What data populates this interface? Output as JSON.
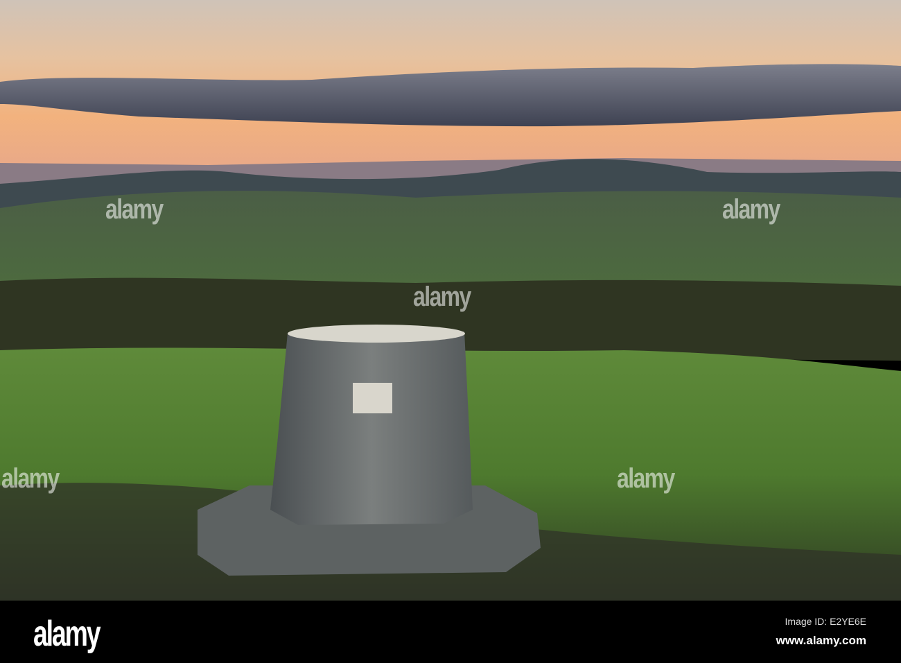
{
  "watermark": {
    "text": "alamy"
  },
  "footer": {
    "logo": "alamy",
    "image_id": "Image ID: E2YE6E",
    "website": "www.alamy.com"
  }
}
